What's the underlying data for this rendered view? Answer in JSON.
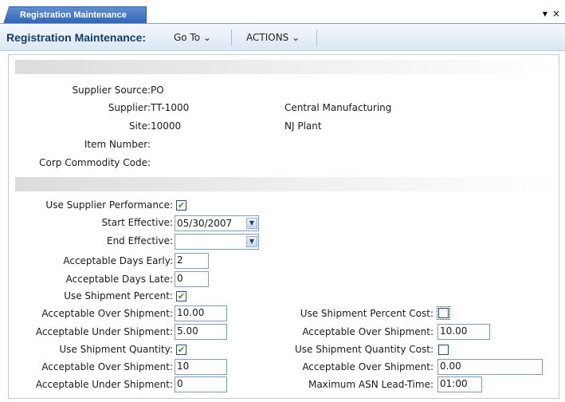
{
  "tab": {
    "label": "Registration Maintenance"
  },
  "window": {
    "menu_icon": "▾",
    "close_icon": "×"
  },
  "toolbar": {
    "title": "Registration Maintenance:",
    "goto": "Go To ⌄",
    "actions": "ACTIONS ⌄"
  },
  "header": {
    "supplier_source": {
      "label": "Supplier Source:",
      "value": "PO"
    },
    "supplier": {
      "label": "Supplier:",
      "value": "TT-1000",
      "desc": "Central Manufacturing"
    },
    "site": {
      "label": "Site:",
      "value": "10000",
      "desc": "NJ Plant"
    },
    "item_number": {
      "label": "Item Number:",
      "value": ""
    },
    "corp_commodity": {
      "label": "Corp Commodity Code:",
      "value": ""
    }
  },
  "form": {
    "use_supplier_performance": {
      "label": "Use Supplier Performance:",
      "checked": true
    },
    "start_effective": {
      "label": "Start Effective:",
      "value": "05/30/2007"
    },
    "end_effective": {
      "label": "End Effective:",
      "value": ""
    },
    "days_early": {
      "label": "Acceptable Days Early:",
      "value": "2"
    },
    "days_late": {
      "label": "Acceptable Days Late:",
      "value": "0"
    },
    "use_ship_percent": {
      "label": "Use Shipment Percent:",
      "checked": true
    },
    "pct_over": {
      "label": "Acceptable Over Shipment:",
      "value": "10.00"
    },
    "pct_under": {
      "label": "Acceptable Under Shipment:",
      "value": "5.00"
    },
    "use_ship_qty": {
      "label": "Use Shipment Quantity:",
      "checked": true
    },
    "qty_over": {
      "label": "Acceptable Over Shipment:",
      "value": "10"
    },
    "qty_under": {
      "label": "Acceptable Under Shipment:",
      "value": "0"
    },
    "use_ship_pct_cost": {
      "label": "Use Shipment Percent Cost:",
      "checked": false
    },
    "pct_cost_over": {
      "label": "Acceptable Over Shipment:",
      "value": "10.00"
    },
    "use_ship_qty_cost": {
      "label": "Use Shipment Quantity Cost:",
      "checked": false
    },
    "qty_cost_over": {
      "label": "Acceptable Over Shipment:",
      "value": "0.00"
    },
    "max_asn_lead": {
      "label": "Maximum ASN Lead-Time:",
      "value": "01:00"
    }
  },
  "icons": {
    "check": "✔",
    "dropdown": "▼"
  }
}
